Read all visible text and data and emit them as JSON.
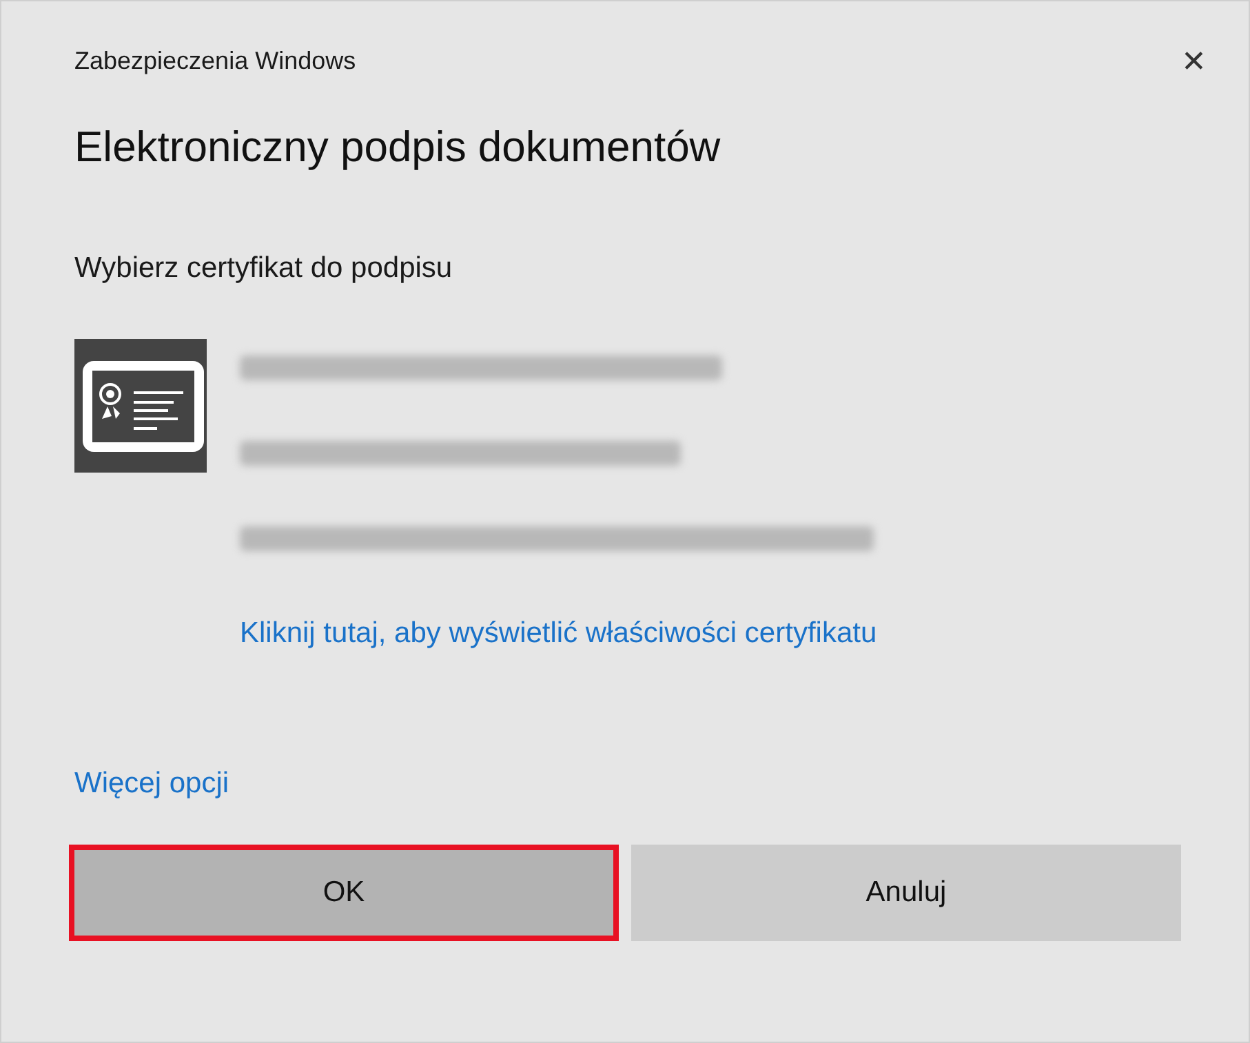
{
  "window": {
    "title": "Zabezpieczenia Windows",
    "close": "✕"
  },
  "heading": "Elektroniczny podpis dokumentów",
  "prompt": "Wybierz certyfikat do podpisu",
  "certificate": {
    "details_link": "Kliknij tutaj, aby wyświetlić właściwości certyfikatu"
  },
  "more_options": "Więcej opcji",
  "buttons": [
    {
      "label": "OK",
      "highlighted": true,
      "kind": "primary"
    },
    {
      "label": "Anuluj",
      "highlighted": false,
      "kind": "secondary"
    }
  ]
}
